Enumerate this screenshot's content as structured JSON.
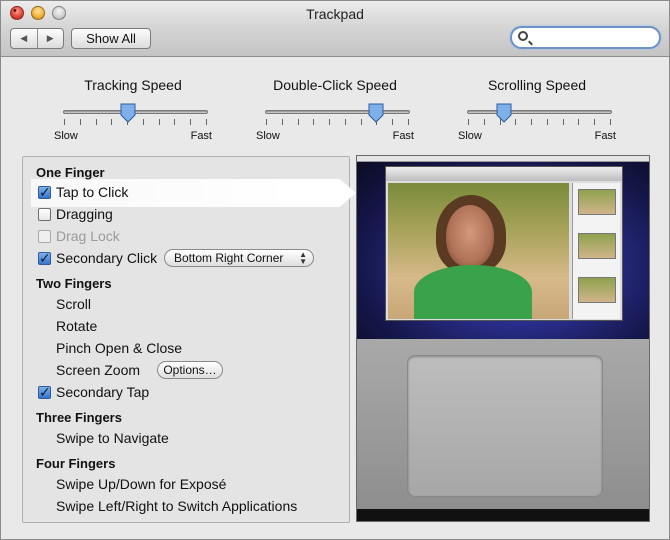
{
  "window": {
    "title": "Trackpad"
  },
  "toolbar": {
    "show_all": "Show All",
    "search_value": ""
  },
  "sliders": [
    {
      "label": "Tracking Speed",
      "min_label": "Slow",
      "max_label": "Fast",
      "value": 0.45
    },
    {
      "label": "Double-Click Speed",
      "min_label": "Slow",
      "max_label": "Fast",
      "value": 0.77
    },
    {
      "label": "Scrolling Speed",
      "min_label": "Slow",
      "max_label": "Fast",
      "value": 0.25
    }
  ],
  "options": {
    "one_finger": {
      "header": "One Finger",
      "tap_to_click": {
        "label": "Tap to Click",
        "checked": true
      },
      "dragging": {
        "label": "Dragging",
        "checked": false
      },
      "drag_lock": {
        "label": "Drag Lock",
        "checked": false,
        "enabled": false
      },
      "secondary_click": {
        "label": "Secondary Click",
        "checked": true,
        "popup_value": "Bottom Right Corner"
      }
    },
    "two_fingers": {
      "header": "Two Fingers",
      "scroll": "Scroll",
      "rotate": "Rotate",
      "pinch": "Pinch Open & Close",
      "screen_zoom": {
        "label": "Screen Zoom",
        "button": "Options…"
      },
      "secondary_tap": {
        "label": "Secondary Tap",
        "checked": true
      }
    },
    "three_fingers": {
      "header": "Three Fingers",
      "swipe": "Swipe to Navigate"
    },
    "four_fingers": {
      "header": "Four Fingers",
      "expose": "Swipe Up/Down for Exposé",
      "switch_apps": "Swipe Left/Right to Switch Applications"
    }
  }
}
